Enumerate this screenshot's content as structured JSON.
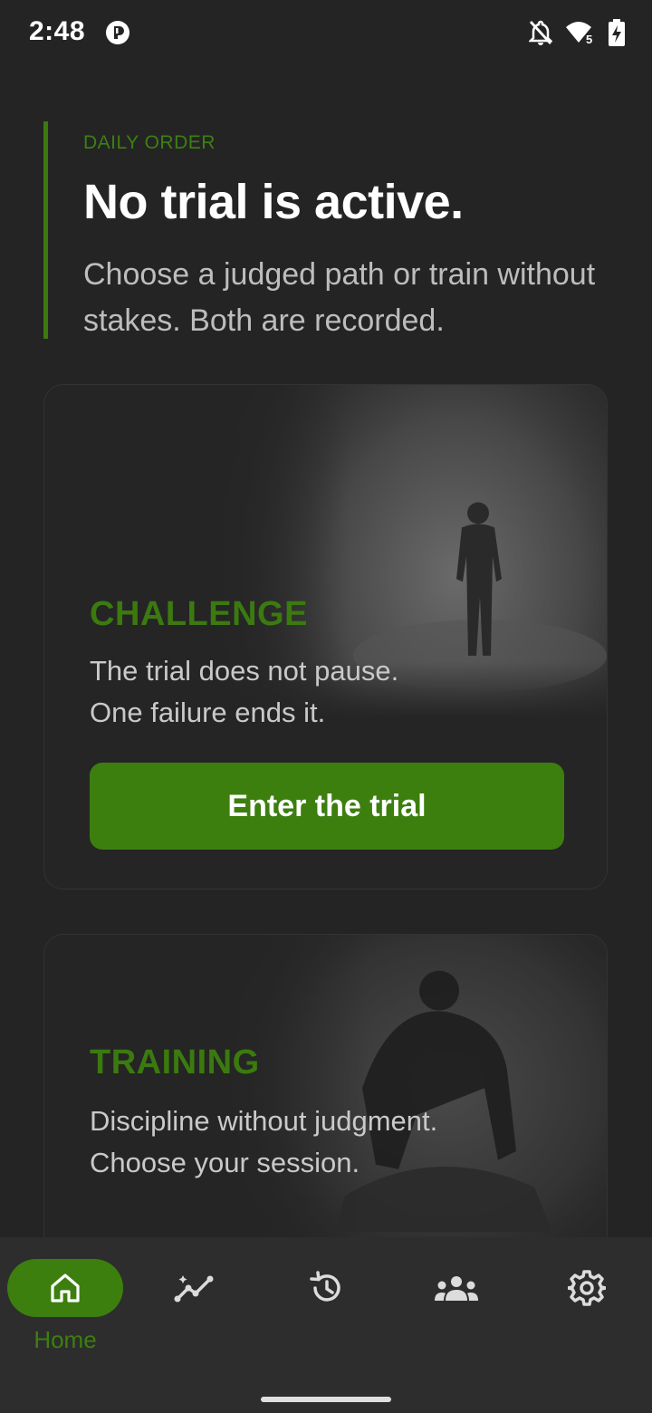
{
  "status_bar": {
    "time": "2:48",
    "wifi_badge": "5"
  },
  "daily": {
    "label": "DAILY ORDER",
    "title": "No trial is active.",
    "subtitle": "Choose a judged path or train without stakes. Both are recorded."
  },
  "challenge": {
    "label": "CHALLENGE",
    "desc_line1": "The trial does not pause.",
    "desc_line2": "One failure ends it.",
    "button": "Enter the trial"
  },
  "training": {
    "label": "TRAINING",
    "desc_line1": "Discipline without judgment.",
    "desc_line2": "Choose your session."
  },
  "nav": {
    "items": [
      {
        "icon": "home-icon",
        "label": "Home",
        "active": true
      },
      {
        "icon": "progress-chart-icon",
        "label": "",
        "active": false
      },
      {
        "icon": "history-icon",
        "label": "",
        "active": false
      },
      {
        "icon": "group-icon",
        "label": "",
        "active": false
      },
      {
        "icon": "settings-icon",
        "label": "",
        "active": false
      }
    ]
  },
  "colors": {
    "accent": "#3c7f0f",
    "background": "#242424",
    "nav_background": "#2d2d2d"
  }
}
